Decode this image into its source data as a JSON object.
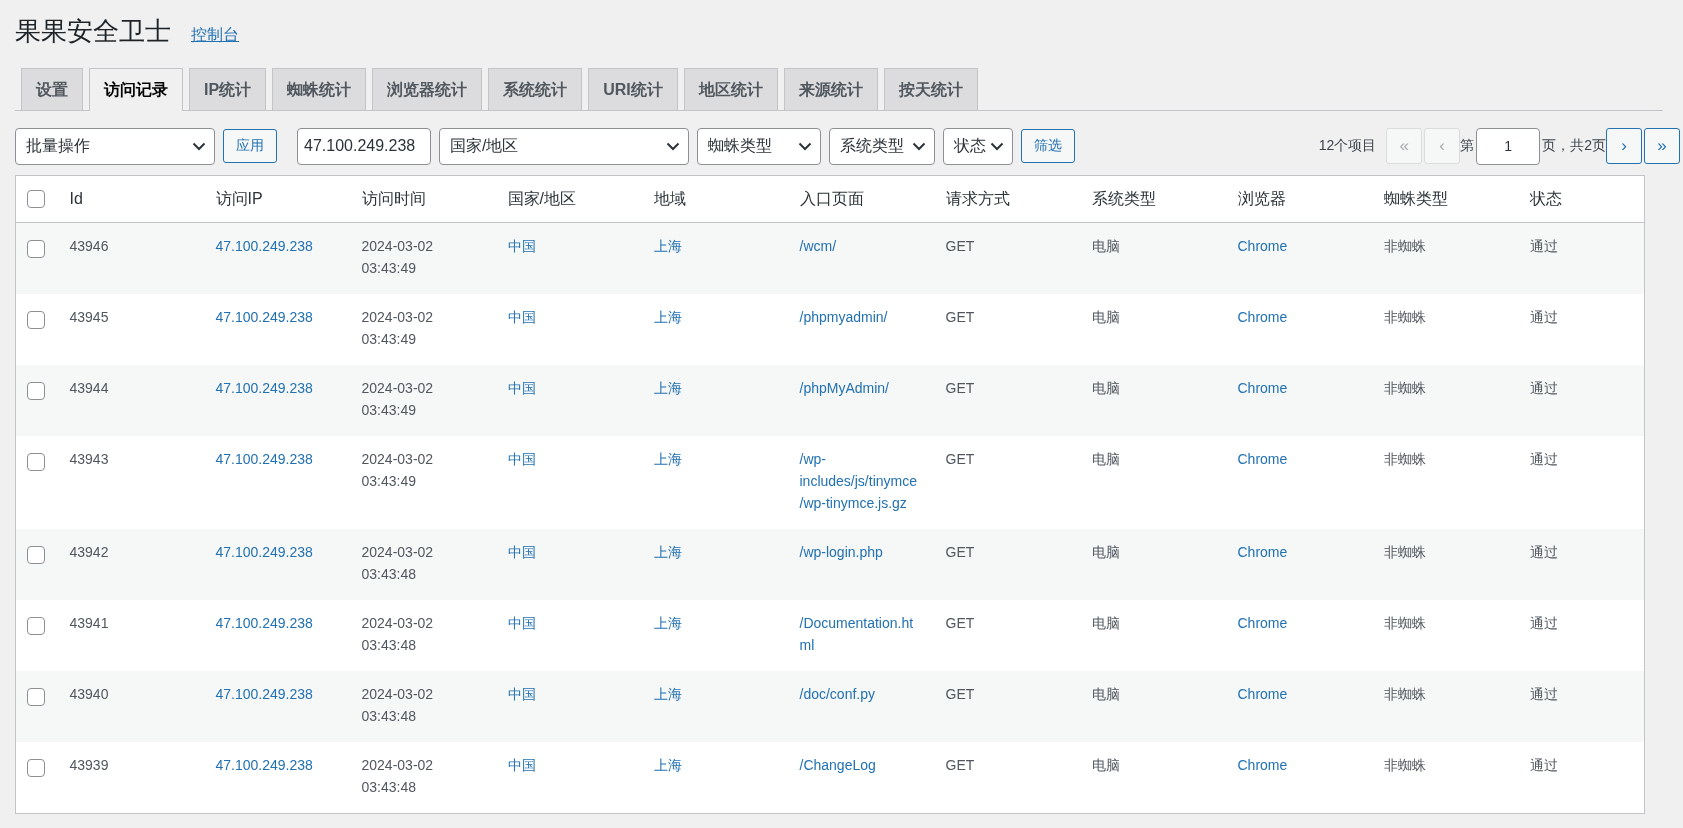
{
  "header": {
    "title": "果果安全卫士",
    "link": "控制台"
  },
  "tabs": [
    {
      "label": "设置",
      "selected": false
    },
    {
      "label": "访问记录",
      "selected": true
    },
    {
      "label": "IP统计",
      "selected": false
    },
    {
      "label": "蜘蛛统计",
      "selected": false
    },
    {
      "label": "浏览器统计",
      "selected": false
    },
    {
      "label": "系统统计",
      "selected": false
    },
    {
      "label": "URI统计",
      "selected": false
    },
    {
      "label": "地区统计",
      "selected": false
    },
    {
      "label": "来源统计",
      "selected": false
    },
    {
      "label": "按天统计",
      "selected": false
    }
  ],
  "filters": {
    "bulk_action": "批量操作",
    "apply_button": "应用",
    "ip_value": "47.100.249.238",
    "country": "国家/地区",
    "spider_type": "蜘蛛类型",
    "system_type": "系统类型",
    "status": "状态",
    "filter_button": "筛选"
  },
  "pagination": {
    "count": "12个项目",
    "first": {
      "label": "«",
      "disabled": true
    },
    "prev": {
      "label": "‹",
      "disabled": true
    },
    "page_prefix": "第",
    "current_page": "1",
    "page_suffix": "页，共2页",
    "next": {
      "label": "›",
      "disabled": false
    },
    "last": {
      "label": "»",
      "disabled": false
    }
  },
  "table": {
    "select_all_checked": false,
    "columns": [
      {
        "label": "Id",
        "kind": "text"
      },
      {
        "label": "访问IP",
        "kind": "link"
      },
      {
        "label": "访问时间",
        "kind": "text"
      },
      {
        "label": "国家/地区",
        "kind": "link"
      },
      {
        "label": "地域",
        "kind": "link"
      },
      {
        "label": "入口页面",
        "kind": "link"
      },
      {
        "label": "请求方式",
        "kind": "text"
      },
      {
        "label": "系统类型",
        "kind": "text"
      },
      {
        "label": "浏览器",
        "kind": "link"
      },
      {
        "label": "蜘蛛类型",
        "kind": "text"
      },
      {
        "label": "状态",
        "kind": "text"
      }
    ],
    "rows": [
      {
        "checked": false,
        "cells": [
          "43946",
          "47.100.249.238",
          "2024-03-02 03:43:49",
          "中国",
          "上海",
          "/wcm/",
          "GET",
          "电脑",
          "Chrome",
          "非蜘蛛",
          "通过"
        ]
      },
      {
        "checked": false,
        "cells": [
          "43945",
          "47.100.249.238",
          "2024-03-02 03:43:49",
          "中国",
          "上海",
          "/phpmyadmin/",
          "GET",
          "电脑",
          "Chrome",
          "非蜘蛛",
          "通过"
        ]
      },
      {
        "checked": false,
        "cells": [
          "43944",
          "47.100.249.238",
          "2024-03-02 03:43:49",
          "中国",
          "上海",
          "/phpMyAdmin/",
          "GET",
          "电脑",
          "Chrome",
          "非蜘蛛",
          "通过"
        ]
      },
      {
        "checked": false,
        "cells": [
          "43943",
          "47.100.249.238",
          "2024-03-02 03:43:49",
          "中国",
          "上海",
          "/wp-includes/js/tinymce/wp-tinymce.js.gz",
          "GET",
          "电脑",
          "Chrome",
          "非蜘蛛",
          "通过"
        ]
      },
      {
        "checked": false,
        "cells": [
          "43942",
          "47.100.249.238",
          "2024-03-02 03:43:48",
          "中国",
          "上海",
          "/wp-login.php",
          "GET",
          "电脑",
          "Chrome",
          "非蜘蛛",
          "通过"
        ]
      },
      {
        "checked": false,
        "cells": [
          "43941",
          "47.100.249.238",
          "2024-03-02 03:43:48",
          "中国",
          "上海",
          "/Documentation.html",
          "GET",
          "电脑",
          "Chrome",
          "非蜘蛛",
          "通过"
        ]
      },
      {
        "checked": false,
        "cells": [
          "43940",
          "47.100.249.238",
          "2024-03-02 03:43:48",
          "中国",
          "上海",
          "/doc/conf.py",
          "GET",
          "电脑",
          "Chrome",
          "非蜘蛛",
          "通过"
        ]
      },
      {
        "checked": false,
        "cells": [
          "43939",
          "47.100.249.238",
          "2024-03-02 03:43:48",
          "中国",
          "上海",
          "/ChangeLog",
          "GET",
          "电脑",
          "Chrome",
          "非蜘蛛",
          "通过"
        ]
      }
    ]
  }
}
